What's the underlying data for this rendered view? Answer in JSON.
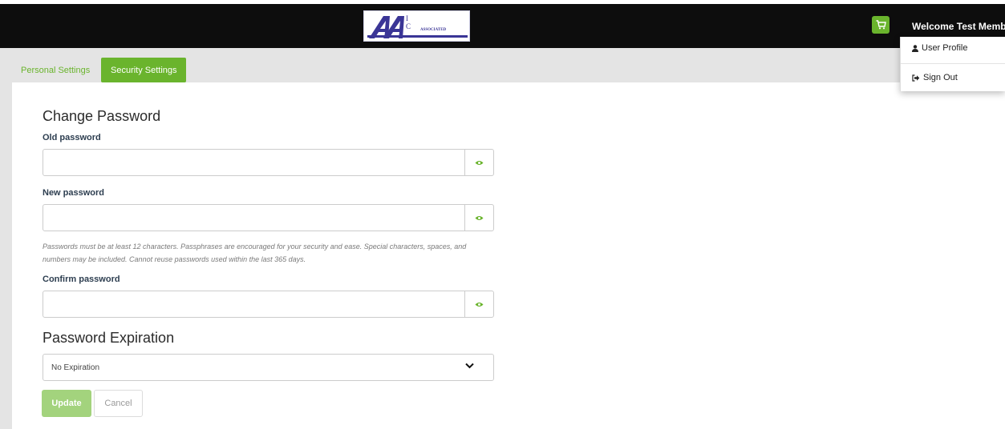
{
  "header": {
    "logo_text_line1": "ASSOCIATED",
    "logo_text_line2": "ADMINISTRATORS",
    "welcome_text": "Welcome Test Member",
    "cart_icon": "shopping-cart-icon"
  },
  "user_menu": {
    "items": [
      {
        "label": "User Profile",
        "icon": "user-icon"
      },
      {
        "label": "Sign Out",
        "icon": "sign-out-icon"
      }
    ]
  },
  "tabs": [
    {
      "label": "Personal Settings",
      "active": false
    },
    {
      "label": "Security Settings",
      "active": true
    }
  ],
  "change_password": {
    "title": "Change Password",
    "old_label": "Old password",
    "old_value": "",
    "new_label": "New password",
    "new_value": "",
    "help_text": "Passwords must be at least 12 characters. Passphrases are encouraged for your security and ease. Special characters, spaces, and numbers may be included. Cannot reuse passwords used within the last 365 days.",
    "confirm_label": "Confirm password",
    "confirm_value": ""
  },
  "password_expiration": {
    "title": "Password Expiration",
    "selected": "No Expiration"
  },
  "actions": {
    "update_label": "Update",
    "cancel_label": "Cancel"
  },
  "colors": {
    "accent": "#6ab42d",
    "header_bg": "#0d0d0d",
    "disabled_button": "#a3d37d",
    "logo_blue": "#3a3596"
  }
}
